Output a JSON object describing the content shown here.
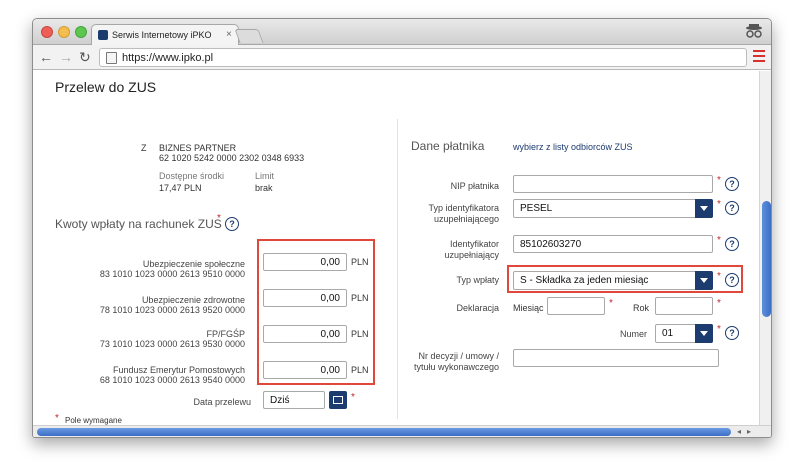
{
  "browser": {
    "tab_title": "Serwis Internetowy iPKO",
    "url": "https://www.ipko.pl"
  },
  "page": {
    "title": "Przelew do ZUS",
    "required_note": "Pole wymagane"
  },
  "sender": {
    "prefix": "Z",
    "name": "BIZNES PARTNER",
    "account": "62 1020 5242 0000 2302 0348 6933",
    "available_label": "Dostępne środki",
    "available_value": "17,47 PLN",
    "limit_label": "Limit",
    "limit_value": "brak"
  },
  "amounts": {
    "section_title": "Kwoty wpłaty na rachunek ZUS",
    "currency": "PLN",
    "rows": [
      {
        "label": "Ubezpieczenie społeczne",
        "account": "83 1010 1023 0000 2613 9510 0000",
        "value": "0,00"
      },
      {
        "label": "Ubezpieczenie zdrowotne",
        "account": "78 1010 1023 0000 2613 9520 0000",
        "value": "0,00"
      },
      {
        "label": "FP/FGŚP",
        "account": "73 1010 1023 0000 2613 9530 0000",
        "value": "0,00"
      },
      {
        "label": "Fundusz Emerytur Pomostowych",
        "account": "68 1010 1023 0000 2613 9540 0000",
        "value": "0,00"
      }
    ],
    "date_label": "Data przelewu",
    "date_value": "Dziś"
  },
  "payer": {
    "section_title": "Dane płatnika",
    "choose_link": "wybierz z listy odbiorców ZUS",
    "nip_label": "NIP płatnika",
    "nip_value": "",
    "id_type_label_1": "Typ identyfikatora",
    "id_type_label_2": "uzupełniającego",
    "id_type_value": "PESEL",
    "id_label_1": "Identyfikator",
    "id_label_2": "uzupełniający",
    "id_value": "85102603270",
    "payment_type_label": "Typ wpłaty",
    "payment_type_value": "S - Składka za jeden miesiąc",
    "declaration_label": "Deklaracja",
    "month_label": "Miesiąc",
    "month_value": "",
    "year_label": "Rok",
    "year_value": "",
    "number_label": "Numer",
    "number_value": "01",
    "decision_label_1": "Nr decyzji / umowy /",
    "decision_label_2": "tytułu wykonawczego",
    "decision_value": ""
  },
  "colors": {
    "accent": "#1c3b6f",
    "highlight": "#e0483c",
    "required": "#c1272d"
  },
  "icons": {
    "help": "?",
    "back": "←",
    "forward": "→",
    "reload": "↻"
  }
}
